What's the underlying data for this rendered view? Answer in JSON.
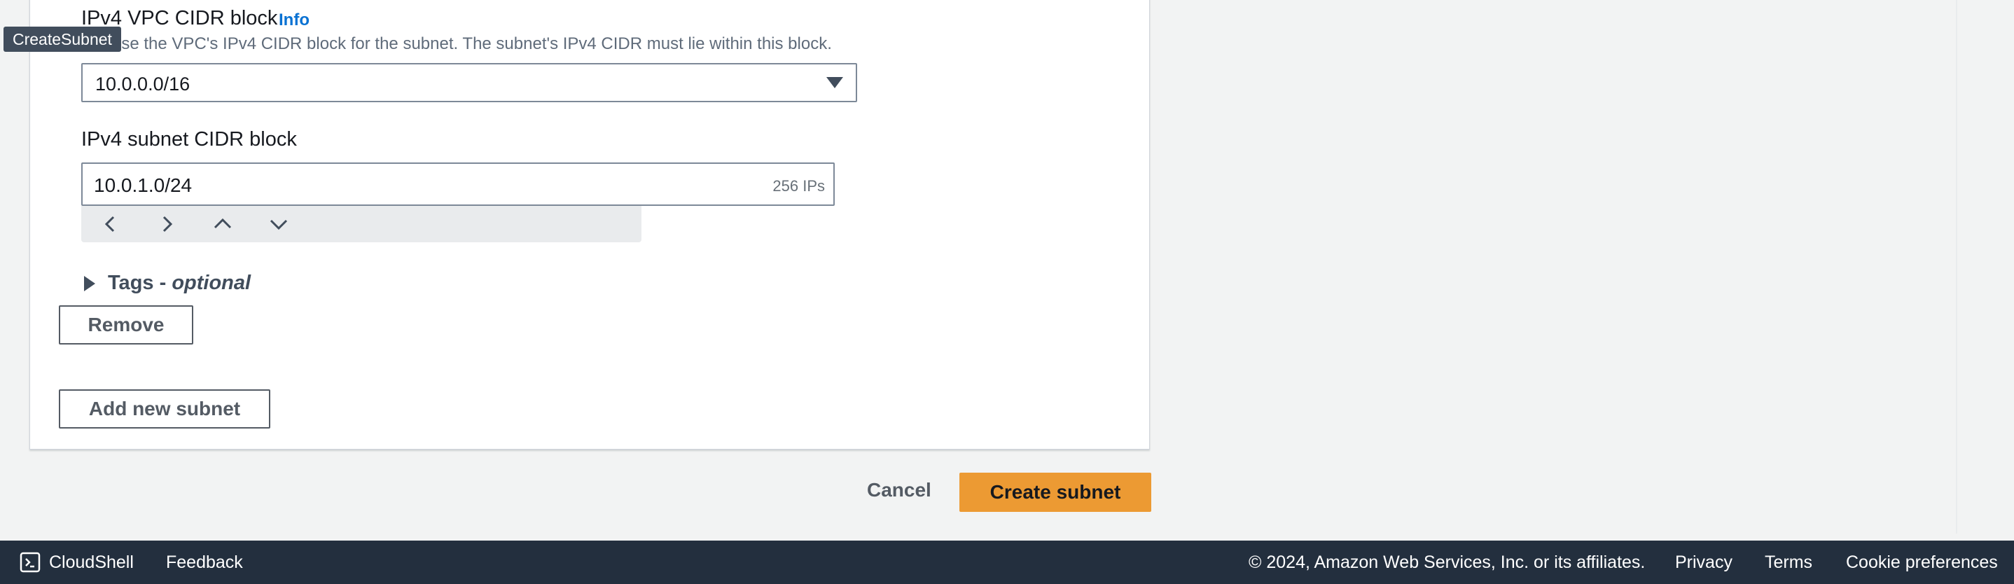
{
  "tooltip": "CreateSubnet",
  "vpc_cidr": {
    "label": "IPv4 VPC CIDR block",
    "info": "Info",
    "description": "Choose the VPC's IPv4 CIDR block for the subnet. The subnet's IPv4 CIDR must lie within this block.",
    "selected": "10.0.0.0/16"
  },
  "subnet_cidr": {
    "label": "IPv4 subnet CIDR block",
    "value": "10.0.1.0/24",
    "suffix": "256 IPs"
  },
  "stepper": {
    "icons": [
      "chevron-left-icon",
      "chevron-right-icon",
      "chevron-up-icon",
      "chevron-down-icon"
    ]
  },
  "tags": {
    "label": "Tags - ",
    "optional": "optional"
  },
  "buttons": {
    "remove": "Remove",
    "add_new_subnet": "Add new subnet",
    "cancel": "Cancel",
    "create_subnet": "Create subnet"
  },
  "footer": {
    "cloudshell": "CloudShell",
    "feedback": "Feedback",
    "copyright": "© 2024, Amazon Web Services, Inc. or its affiliates.",
    "privacy": "Privacy",
    "terms": "Terms",
    "cookie_preferences": "Cookie preferences"
  },
  "colors": {
    "primary_button": "#ec9a33",
    "link": "#0972d3",
    "footer_bg": "#232f3e"
  }
}
